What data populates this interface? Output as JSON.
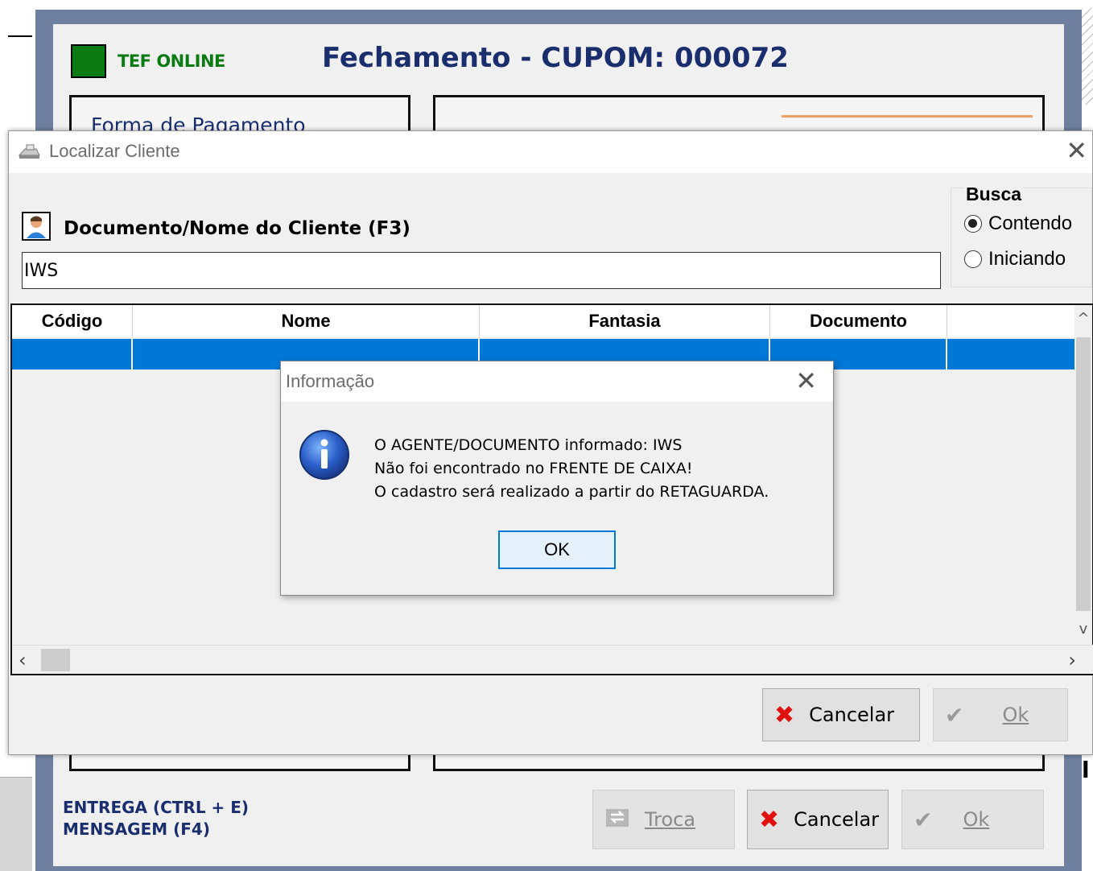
{
  "background_window": {
    "tef_status": "TEF ONLINE",
    "title": "Fechamento - CUPOM: 000072",
    "forma_pagamento_label": "Forma de Pagamento",
    "bottom_links": [
      "ENTREGA (CTRL + E)",
      "MENSAGEM (F4)"
    ],
    "buttons": {
      "troca": "Troca",
      "cancelar": "Cancelar",
      "ok": "Ok"
    },
    "side_glyph": "l"
  },
  "localizar_dialog": {
    "title": "Localizar Cliente",
    "search_label": "Documento/Nome do Cliente (F3)",
    "search_value": "IWS",
    "busca": {
      "title": "Busca",
      "options": [
        {
          "label": "Contendo",
          "selected": true
        },
        {
          "label": "Iniciando",
          "selected": false
        }
      ]
    },
    "grid_columns": [
      "Código",
      "Nome",
      "Fantasia",
      "Documento"
    ],
    "buttons": {
      "cancelar": "Cancelar",
      "ok": "Ok"
    }
  },
  "info_dialog": {
    "title": "Informação",
    "lines": [
      "O AGENTE/DOCUMENTO informado: IWS",
      "Não foi encontrado no FRENTE DE CAIXA!",
      "O cadastro será realizado a partir do RETAGUARDA."
    ],
    "ok_label": "OK"
  },
  "icons": {
    "close": "close-icon",
    "info": "info-icon",
    "user": "user-icon",
    "cancel": "x-icon",
    "confirm": "check-icon",
    "exchange": "exchange-icon"
  },
  "colors": {
    "frame": "#6f7fa0",
    "title_text": "#1a2e6e",
    "tef_green": "#0a7a12",
    "selection": "#0078d7",
    "cancel_red": "#e01010"
  }
}
